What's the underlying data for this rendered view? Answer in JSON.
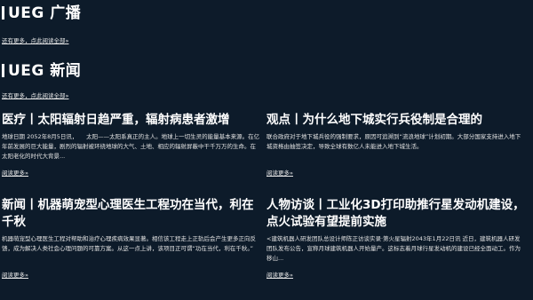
{
  "broadcast": {
    "title": "UEG 广播",
    "more_link": "还有更多，点此阅读全部»"
  },
  "news": {
    "title": "UEG 新闻",
    "more_link": "还有更多，点此阅读全部»",
    "articles": [
      {
        "title": "医疗丨太阳辐射日趋严重，辐射病患者激增",
        "summary": "地球日期 2052年8月5日讯，　　太阳——太阳系真正的主人。地球上一切生灵的能量基本来源。在亿年前发展的巨大能量，剧烈的辐射被环绕地球的大气、土地、相应的辐射屏蔽中干千万万的生命。在太阳老化的时代大背景...",
        "more": "阅读更多»"
      },
      {
        "title": "观点丨为什么地下城实行兵役制是合理的",
        "summary": "联合政府对于地下城兵役的强制要求，原因可追溯到“流浪地球”计划初期。大部分国家支持进入地下城资格由抽签决定，导致全球有数亿人未能进入地下城生活。",
        "more": "阅读更多»"
      },
      {
        "title": "新闻丨机器萌宠型心理医生工程功在当代，利在千秋",
        "summary": "机器萌宠型心理医生工程对帮助和治疗心理疾病效果显著。相信该工程走上正轨后会产生更多正向反馈，成为解决人类社会心理问题的可靠方案。从这一点上讲，该项目正可谓“功在当代，利在千秋。”",
        "more": "阅读更多»"
      },
      {
        "title": "人物访谈丨工业化3D打印助推行星发动机建设，点火试验有望提前实施",
        "summary": "<建筑机器人研发团队总设计师陈正访谈实录·第火星辐射2043年1月22日讯 近日，建筑机器人研发团队发布公告，宣称月球建筑机器人开始量产。这标志着月球行星发动机的建设已经全面动工。作为移山...",
        "more": "阅读更多»"
      }
    ]
  }
}
